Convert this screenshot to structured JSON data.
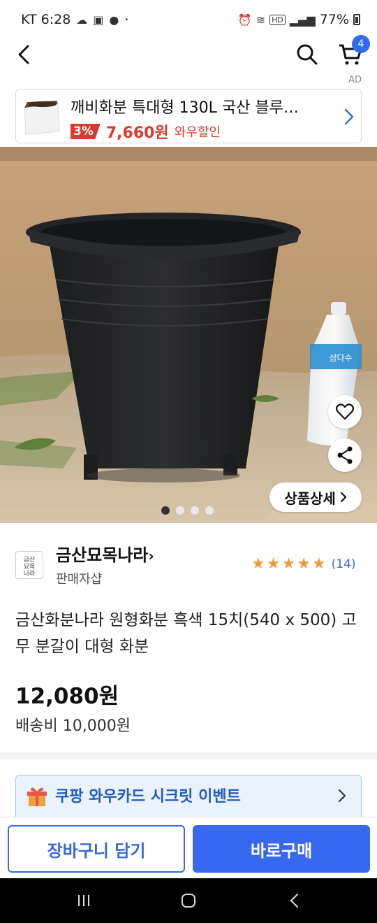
{
  "status_bar": {
    "carrier_time": "KT 6:28",
    "battery": "77%",
    "network": "HD"
  },
  "nav": {
    "cart_count": "4"
  },
  "ad": {
    "label": "AD",
    "title": "깨비화분 특대형 130L 국산 블루…",
    "discount": "3%",
    "price": "7,660원",
    "wow": "와우할인"
  },
  "hero": {
    "detail_label": "상품상세",
    "slide_count": 4,
    "active_slide": 1,
    "bottle_label": "삼다수"
  },
  "seller": {
    "logo_text": "금산묘목나라",
    "name": "금산묘목나라",
    "sub": "판매자샵",
    "rating_stars": 5,
    "review_count": "(14)",
    "star_color": "#f19a35"
  },
  "product": {
    "title": "금산화분나라 원형화분 흑색 15치(540 x 500) 고무 분갈이 대형 화분",
    "price": "12,080원",
    "shipping": "배송비 10,000원"
  },
  "promo": {
    "text": "쿠팡 와우카드 시크릿 이벤트"
  },
  "actions": {
    "add_to_cart": "장바구니 담기",
    "buy_now": "바로구매",
    "accent": "#3968f0"
  }
}
